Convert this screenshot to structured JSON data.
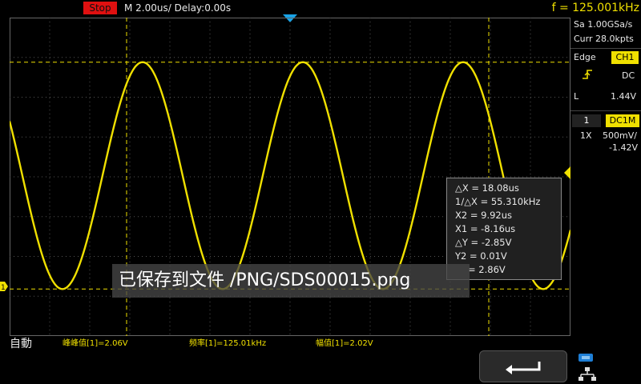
{
  "status": {
    "run_state": "Stop",
    "timebase": "M 2.00us/",
    "delay": "Delay:0.00s",
    "frequency": "f = 125.001kHz"
  },
  "side_panel": {
    "sample_rate": "Sa 1.00GSa/s",
    "memory": "Curr 28.0kpts",
    "trigger_type": "Edge",
    "trigger_source": "CH1",
    "trigger_slope_icon": "rising-edge-icon",
    "trigger_coupling": "DC",
    "trigger_level_label": "L",
    "trigger_level": "1.44V",
    "channel_number": "1",
    "channel_coupling": "DC1M",
    "probe": "1X",
    "volts_per_div": "500mV/",
    "offset": "-1.42V"
  },
  "cursor_readout": {
    "lines": [
      "△X = 18.08us",
      "1/△X = 55.310kHz",
      "X2 = 9.92us",
      "X1 = -8.16us",
      "△Y = -2.85V",
      "Y2 = 0.01V",
      "= 2.86V"
    ]
  },
  "toast": {
    "message": "已保存到文件 /PNG/SDS00015.png"
  },
  "ground_marker": "1",
  "bottom": {
    "mode": "自動",
    "measurements": [
      "峰峰值[1]=2.06V",
      "频率[1]=125.01kHz",
      "幅值[1]=2.02V"
    ],
    "back_icon": "back-arrow-icon",
    "usb_icon": "usb-icon",
    "network_icon": "network-icon"
  },
  "colors": {
    "trace": "#f0e000",
    "stop": "#e01010",
    "trigger_marker": "#19a3e6",
    "cursor": "#f0e000"
  }
}
